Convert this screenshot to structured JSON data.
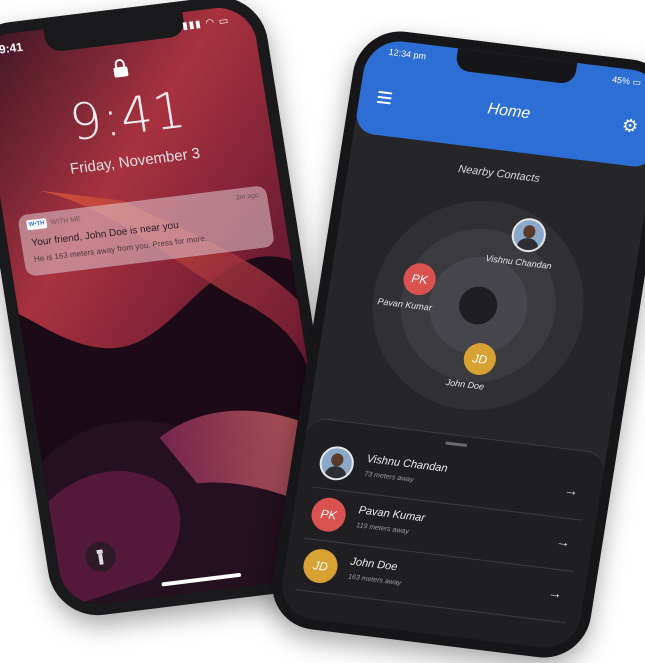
{
  "lock_screen": {
    "status_time": "9:41",
    "status_icons": "▮▮▮ ◠ ▭",
    "clock": "9:41",
    "date": "Friday, November 3",
    "notification": {
      "app_icon_text": "W•TH",
      "app_name": "WITH ME",
      "time": "3m ago",
      "title": "Your friend, John Doe is near you",
      "body": "He is 163 meters away from you. Press for more."
    }
  },
  "app": {
    "status_time": "12:34 pm",
    "battery": "45% ▭",
    "header_title": "Home",
    "section_title": "Nearby Contacts",
    "accent_color": "#2d6ed4",
    "radar": [
      {
        "name": "Vishnu Chandan",
        "initials": "",
        "avatar": "photo"
      },
      {
        "name": "Pavan Kumar",
        "initials": "PK",
        "color": "#d9524f"
      },
      {
        "name": "John Doe",
        "initials": "JD",
        "color": "#d7a233"
      }
    ],
    "contacts": [
      {
        "name": "Vishnu Chandan",
        "distance": "73 meters away",
        "initials": ""
      },
      {
        "name": "Pavan Kumar",
        "distance": "119 meters away",
        "initials": "PK"
      },
      {
        "name": "John Doe",
        "distance": "163 meters away",
        "initials": "JD"
      }
    ],
    "arrow": "→"
  }
}
